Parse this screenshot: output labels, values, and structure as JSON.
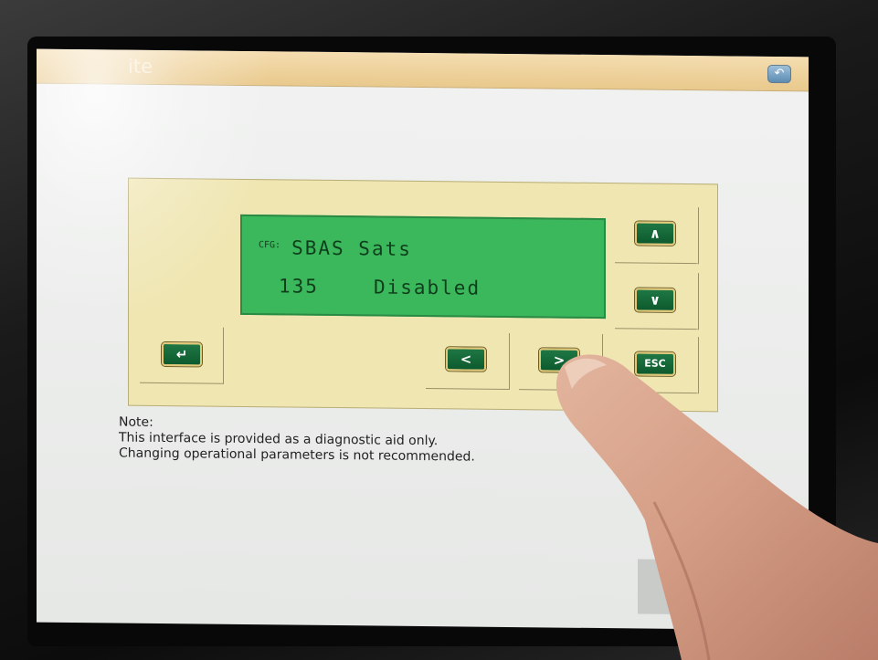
{
  "window": {
    "title": "ite",
    "back_button_label": "↶"
  },
  "lcd": {
    "prefix": "CFG:",
    "line1": "SBAS Sats",
    "line2_code": "135",
    "line2_value": "Disabled"
  },
  "keys": {
    "up": "∧",
    "down": "∨",
    "enter": "↵",
    "left": "<",
    "right": ">",
    "esc": "ESC"
  },
  "note": {
    "heading": "Note:",
    "line1": "This interface is provided as a diagnostic aid only.",
    "line2": "Changing operational parameters is not recommended."
  },
  "colors": {
    "lcd_background": "#3cb85c",
    "lcd_text": "#0f3e1c",
    "panel": "#efe6b2",
    "key": "#0d5a2e",
    "titlebar": "#e9c98c"
  }
}
